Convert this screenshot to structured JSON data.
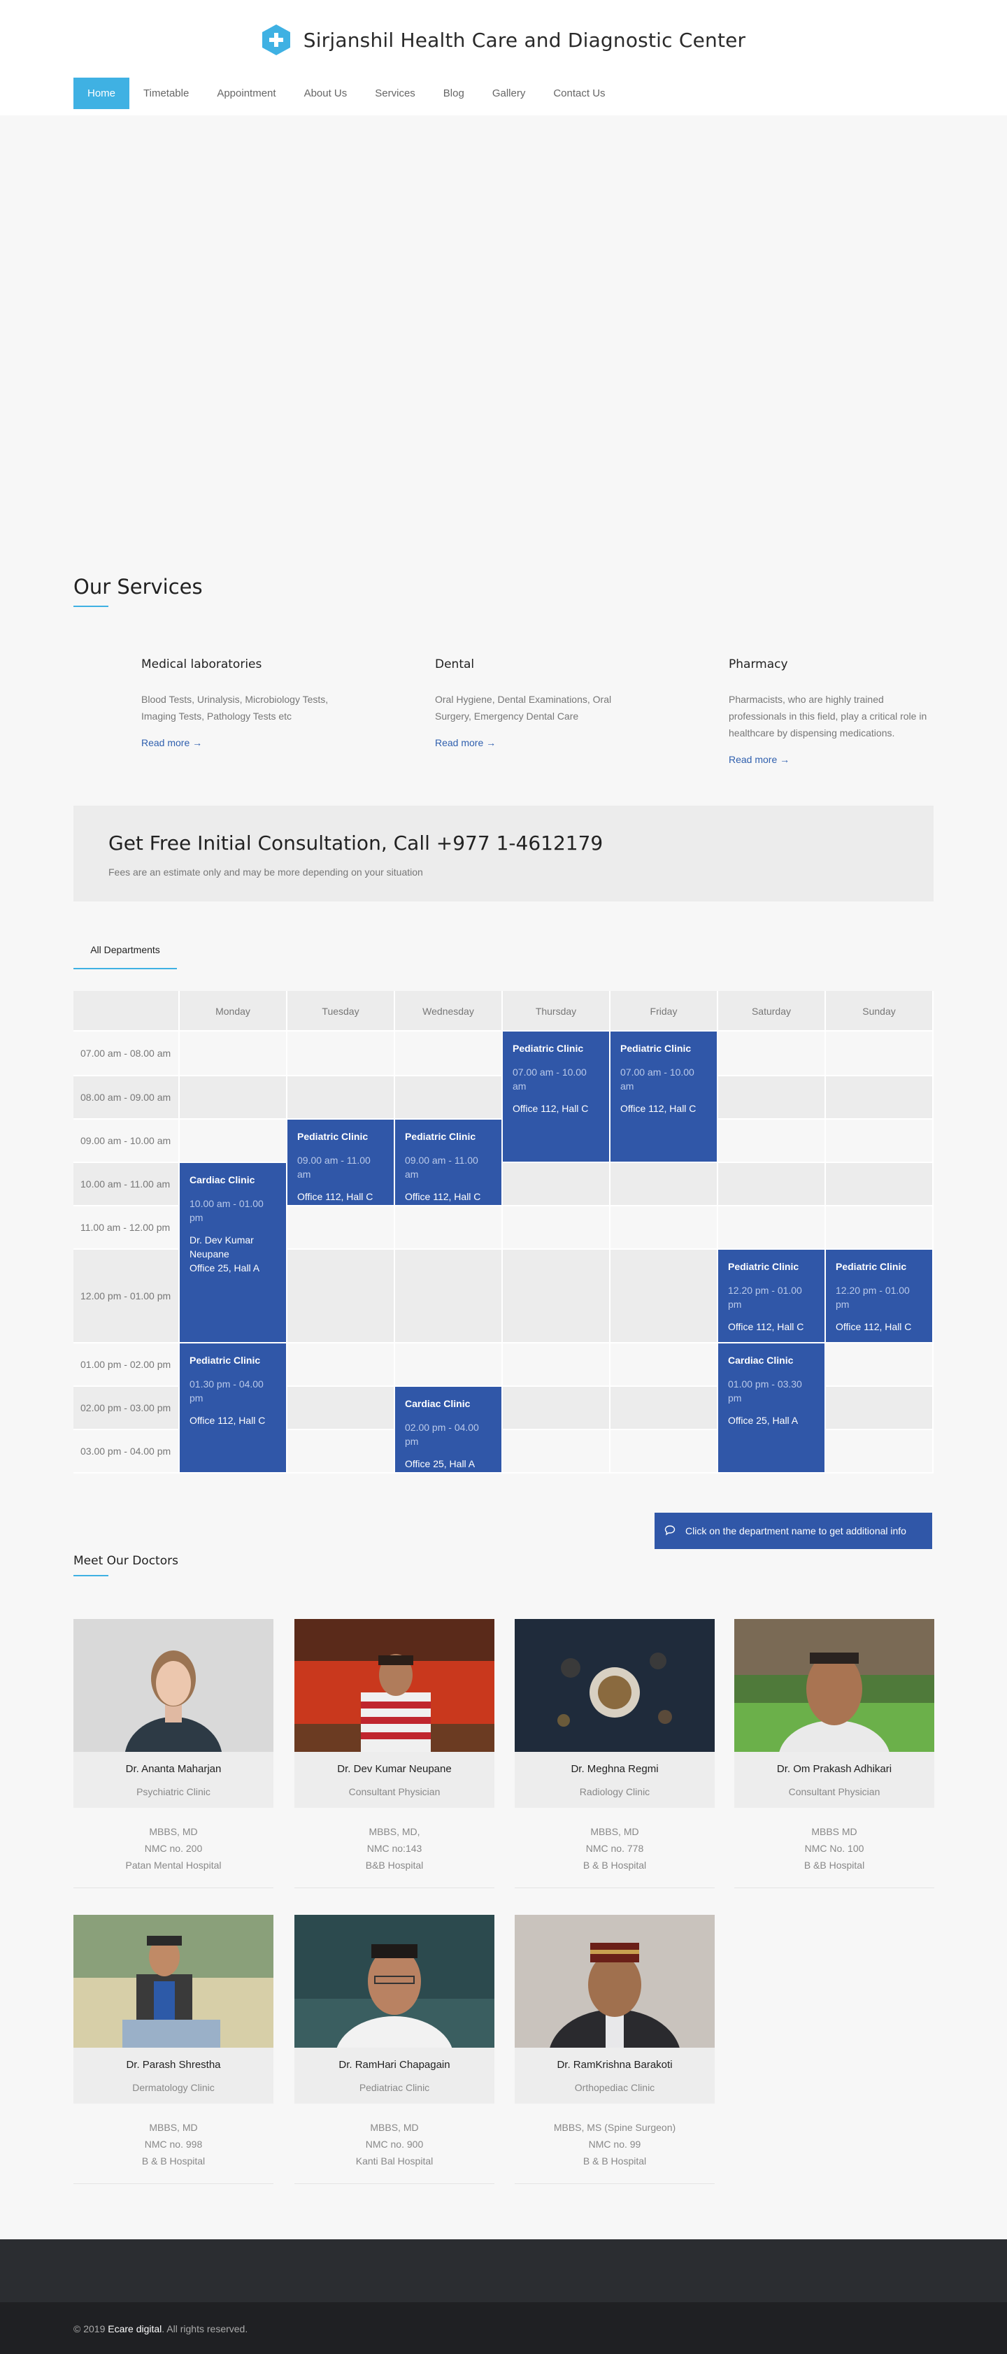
{
  "site": {
    "title": "Sirjanshil Health Care and Diagnostic Center",
    "accent": "#3fb1e3",
    "primary": "#3057a8"
  },
  "nav": [
    "Home",
    "Timetable",
    "Appointment",
    "About Us",
    "Services",
    "Blog",
    "Gallery",
    "Contact Us"
  ],
  "services": {
    "title": "Our Services",
    "items": [
      {
        "title": "Medical laboratories",
        "text": "Blood Tests, Urinalysis, Microbiology Tests, Imaging Tests, Pathology Tests etc",
        "more": "Read more"
      },
      {
        "title": "Dental",
        "text": "Oral Hygiene, Dental Examinations, Oral Surgery, Emergency Dental Care",
        "more": "Read more"
      },
      {
        "title": "Pharmacy",
        "text": "Pharmacists, who are highly trained professionals in this field, play a critical role in healthcare by dispensing medications.",
        "more": "Read more"
      }
    ]
  },
  "consult": {
    "title": "Get Free Initial Consultation, Call +977 1-4612179",
    "note": "Fees are an estimate only and may be more depending on your situation"
  },
  "timetable": {
    "tab": "All Departments",
    "days": [
      "Monday",
      "Tuesday",
      "Wednesday",
      "Thursday",
      "Friday",
      "Saturday",
      "Sunday"
    ],
    "times": [
      "07.00 am - 08.00 am",
      "08.00 am - 09.00 am",
      "09.00 am - 10.00 am",
      "10.00 am - 11.00 am",
      "11.00 am - 12.00 pm",
      "12.00 pm - 01.00 pm",
      "01.00 pm - 02.00 pm",
      "02.00 pm - 03.00 pm",
      "03.00 pm - 04.00 pm"
    ],
    "events": [
      {
        "day": 3,
        "start": 0,
        "end": 3,
        "title": "Pediatric Clinic",
        "time": "07.00 am - 10.00 am",
        "doctor": "",
        "room": "Office 112, Hall C"
      },
      {
        "day": 4,
        "start": 0,
        "end": 3,
        "title": "Pediatric Clinic",
        "time": "07.00 am - 10.00 am",
        "doctor": "",
        "room": "Office 112, Hall C"
      },
      {
        "day": 1,
        "start": 2,
        "end": 4,
        "title": "Pediatric Clinic",
        "time": "09.00 am - 11.00 am",
        "doctor": "",
        "room": "Office 112, Hall C"
      },
      {
        "day": 2,
        "start": 2,
        "end": 4,
        "title": "Pediatric Clinic",
        "time": "09.00 am - 11.00 am",
        "doctor": "",
        "room": "Office 112, Hall C"
      },
      {
        "day": 0,
        "start": 3,
        "end": 6,
        "title": "Cardiac Clinic",
        "time": "10.00 am - 01.00 pm",
        "doctor": "Dr. Dev Kumar Neupane",
        "room": "Office 25, Hall A"
      },
      {
        "day": 5,
        "start": 5,
        "end": 6,
        "title": "Pediatric Clinic",
        "time": "12.20 pm - 01.00 pm",
        "doctor": "",
        "room": "Office 112, Hall C"
      },
      {
        "day": 6,
        "start": 5,
        "end": 6,
        "title": "Pediatric Clinic",
        "time": "12.20 pm - 01.00 pm",
        "doctor": "",
        "room": "Office 112, Hall C"
      },
      {
        "day": 0,
        "start": 6,
        "end": 9,
        "title": "Pediatric Clinic",
        "time": "01.30 pm - 04.00 pm",
        "doctor": "",
        "room": "Office 112, Hall C"
      },
      {
        "day": 5,
        "start": 6,
        "end": 9,
        "title": "Cardiac Clinic",
        "time": "01.00 pm - 03.30 pm",
        "doctor": "",
        "room": "Office 25, Hall A"
      },
      {
        "day": 2,
        "start": 7,
        "end": 9,
        "title": "Cardiac Clinic",
        "time": "02.00 pm - 04.00 pm",
        "doctor": "",
        "room": "Office 25, Hall A"
      }
    ],
    "info": "Click on the department name to get additional info"
  },
  "doctors": {
    "title": "Meet Our Doctors",
    "items": [
      {
        "name": "Dr. Ananta Maharjan",
        "dept": "Psychiatric Clinic",
        "line1": "MBBS, MD",
        "line2": "NMC no. 200",
        "line3": "Patan Mental Hospital"
      },
      {
        "name": "Dr. Dev Kumar Neupane",
        "dept": "Consultant Physician",
        "line1": "MBBS, MD,",
        "line2": "NMC no:143",
        "line3": "B&B Hospital"
      },
      {
        "name": "Dr. Meghna Regmi",
        "dept": "Radiology Clinic",
        "line1": "MBBS, MD",
        "line2": "NMC no. 778",
        "line3": "B & B Hospital"
      },
      {
        "name": "Dr. Om Prakash Adhikari",
        "dept": "Consultant Physician",
        "line1": "MBBS MD",
        "line2": "NMC No. 100",
        "line3": "B &B Hospital"
      },
      {
        "name": "Dr. Parash Shrestha",
        "dept": "Dermatology Clinic",
        "line1": "MBBS, MD",
        "line2": "NMC no. 998",
        "line3": "B & B Hospital"
      },
      {
        "name": "Dr. RamHari Chapagain",
        "dept": "Pediatriac Clinic",
        "line1": "MBBS, MD",
        "line2": "NMC no. 900",
        "line3": "Kanti Bal Hospital"
      },
      {
        "name": "Dr. RamKrishna Barakoti",
        "dept": "Orthopediac Clinic",
        "line1": "MBBS, MS (Spine Surgeon)",
        "line2": "NMC no. 99",
        "line3": "B & B Hospital"
      }
    ]
  },
  "footer": {
    "prefix": "© 2019 ",
    "brand": "Ecare digital",
    "suffix": ". All rights reserved."
  }
}
